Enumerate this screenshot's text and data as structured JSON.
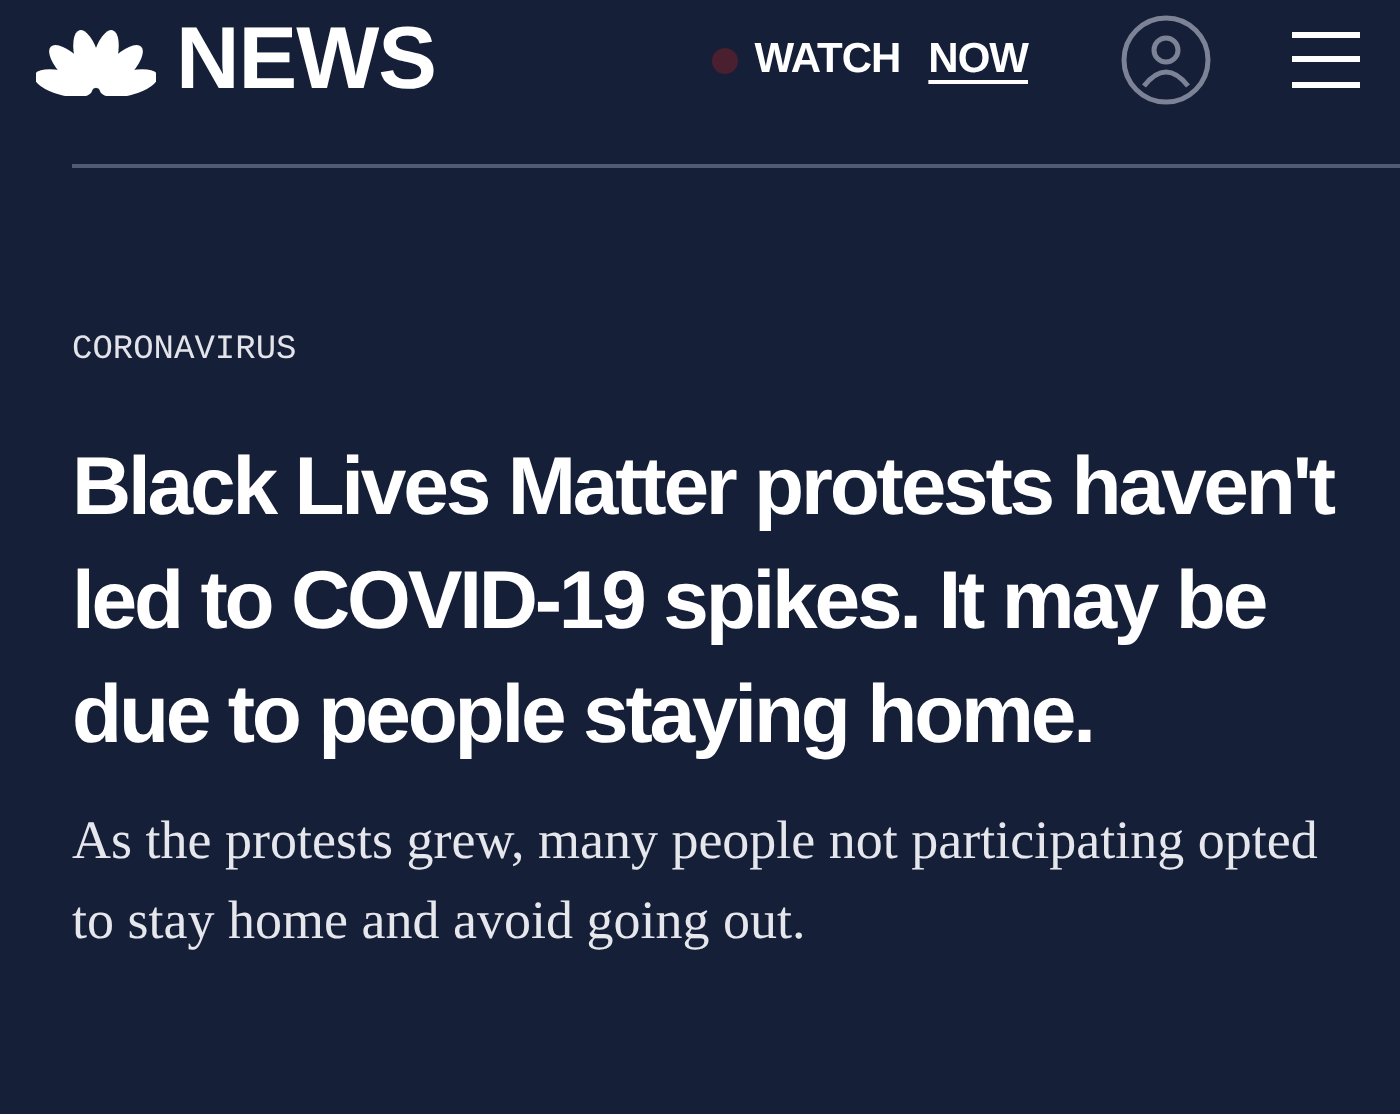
{
  "header": {
    "logo_text": "NEWS",
    "watch": {
      "live": true,
      "label": "WATCH",
      "emphasis": "NOW"
    }
  },
  "article": {
    "category": "CORONAVIRUS",
    "headline": "Black Lives Matter protests haven't led to COVID-19 spikes. It may be due to people staying home.",
    "dek": "As the protests grew, many people not participating opted to stay home and avoid going out."
  }
}
